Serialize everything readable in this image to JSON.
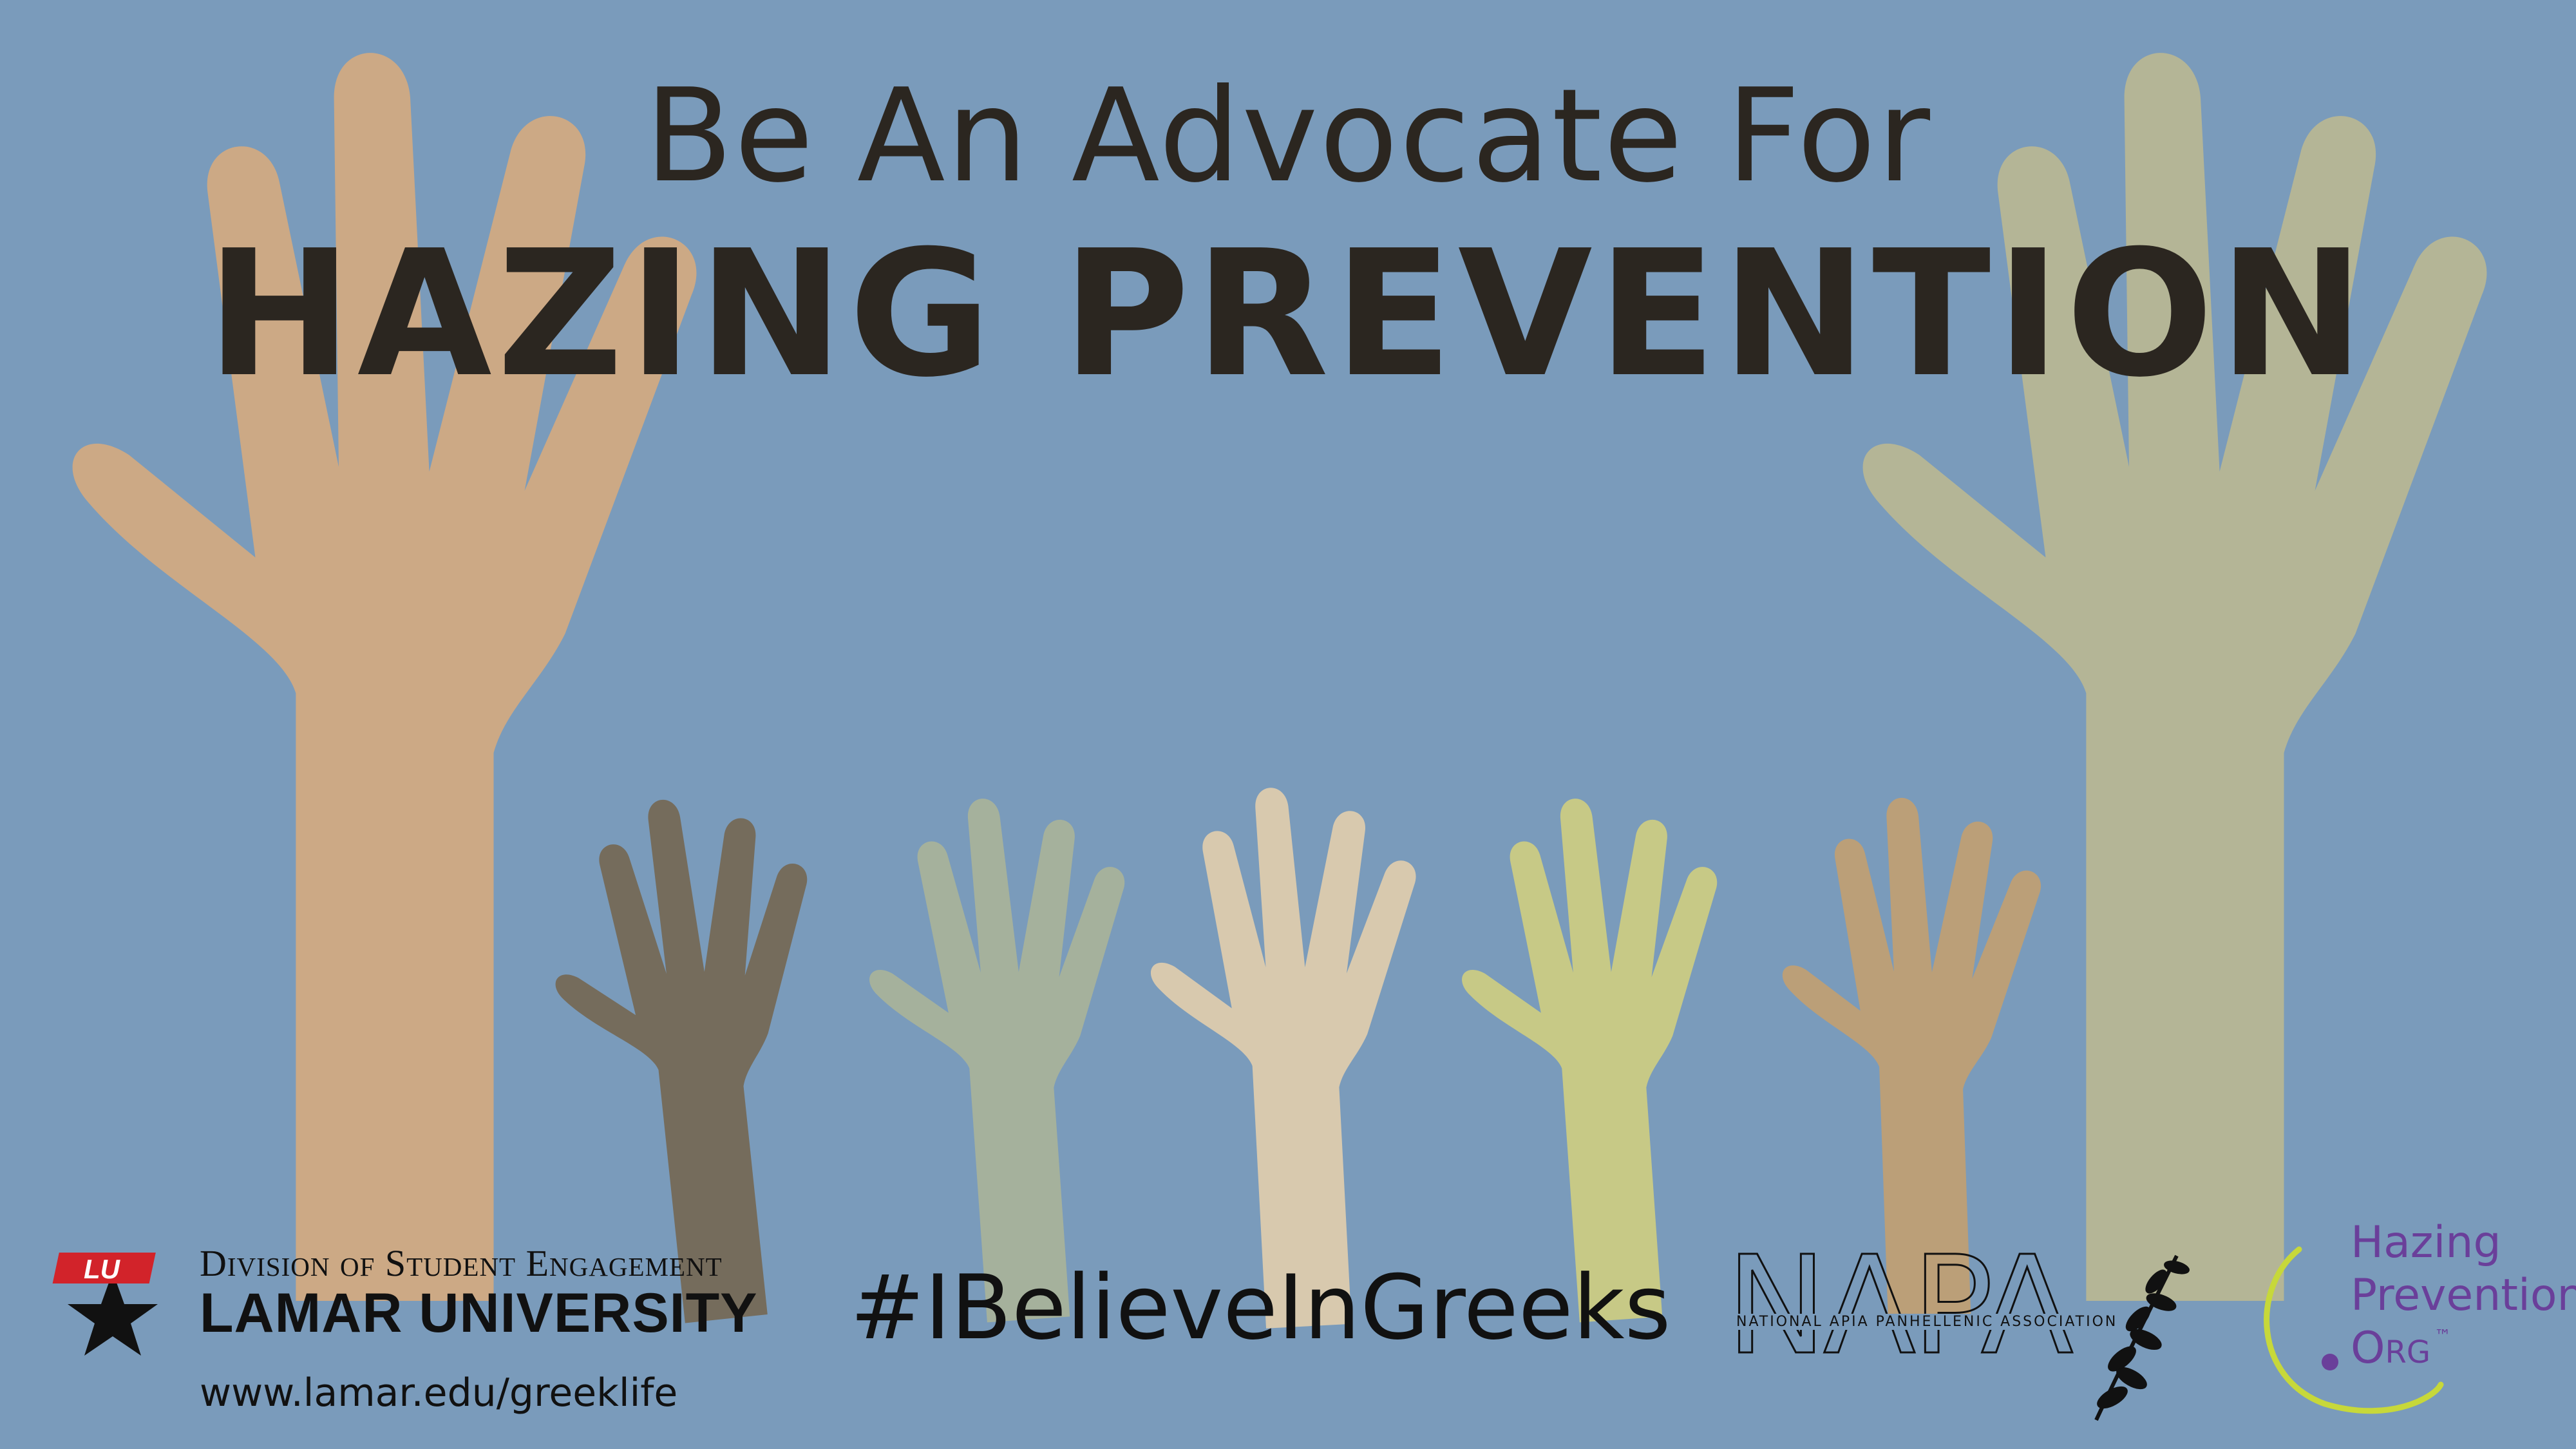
{
  "headline": {
    "line1": "Be An Advocate For",
    "line2": "HAZING PREVENTION"
  },
  "hashtag": "#IBelieveInGreeks",
  "lamar": {
    "division": "Division of Student Engagement",
    "name": "LAMAR UNIVERSITY",
    "url": "www.lamar.edu/greeklife",
    "logo_text": "LU"
  },
  "napa": {
    "logo_text": "NAPA",
    "full_name": "NATIONAL APIA PANHELLENIC ASSOCIATION"
  },
  "hazing_prevention_org": {
    "line1": "Hazing",
    "line2": "Prevention",
    "line3": "Org",
    "tm": "™"
  },
  "colors": {
    "background": "#7a9bbb",
    "text_dark": "#2b2620",
    "hand_left_large": "#cca985",
    "hand_right_large": "#b4b596",
    "hand_1": "#756c5c",
    "hand_2": "#a5b19c",
    "hand_3": "#d8c9ae",
    "hand_4": "#c7c986",
    "hand_5": "#bb9f78",
    "lamar_red": "#d2232a",
    "hp_purple": "#6a3f9a",
    "hp_lime": "#c7d83a"
  }
}
